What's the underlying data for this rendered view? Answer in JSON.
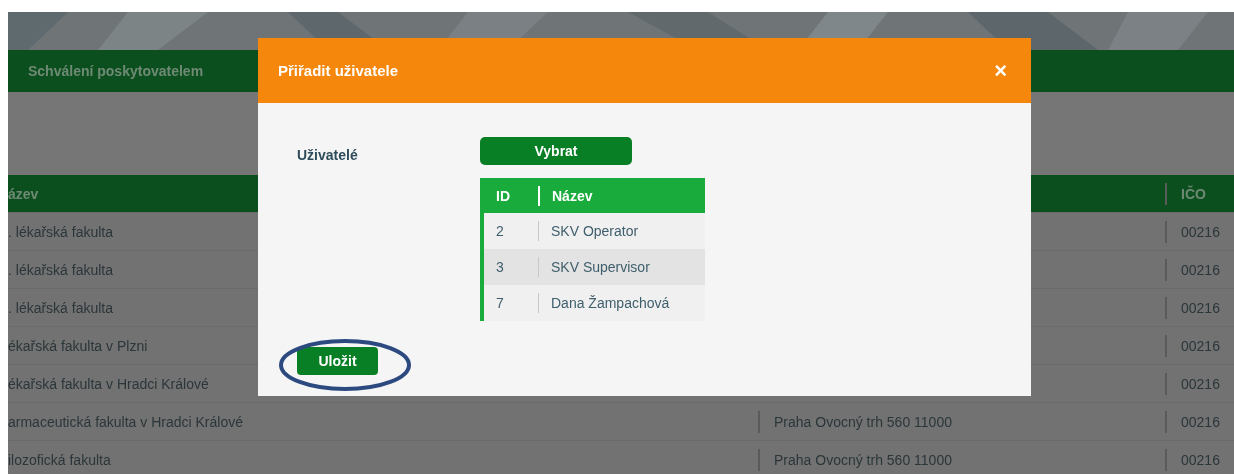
{
  "nav": {
    "item": "Schválení poskytovatelem"
  },
  "table": {
    "columns": [
      {
        "label": "ázev"
      },
      {
        "label": "IČO"
      }
    ],
    "rows": [
      {
        "name": ". lékařská fakulta",
        "ico": "00216"
      },
      {
        "name": ". lékařská fakulta",
        "ico": "00216"
      },
      {
        "name": ". lékařská fakulta",
        "ico": "00216"
      },
      {
        "name": "ékařská fakulta v Plzni",
        "ico": "00216"
      },
      {
        "name": "ékařská fakulta v Hradci Králové",
        "ico": "00216"
      },
      {
        "name": "armaceutická fakulta v Hradci Králové",
        "address": "Praha Ovocný trh 560 11000",
        "ico": "00216"
      },
      {
        "name": "ilozofická fakulta",
        "address": "Praha Ovocný trh 560 11000",
        "ico": "00216"
      }
    ]
  },
  "dialog": {
    "title": "Přiřadit uživatele",
    "close": "×",
    "field_label": "Uživatelé",
    "select_button": "Vybrat",
    "users": {
      "columns": [
        "ID",
        "Název"
      ],
      "rows": [
        {
          "id": "2",
          "name": "SKV Operator",
          "selected": false
        },
        {
          "id": "3",
          "name": "SKV Supervisor",
          "selected": true
        },
        {
          "id": "7",
          "name": "Dana Žampachová",
          "selected": false
        }
      ]
    },
    "save_button": "Uložit"
  }
}
